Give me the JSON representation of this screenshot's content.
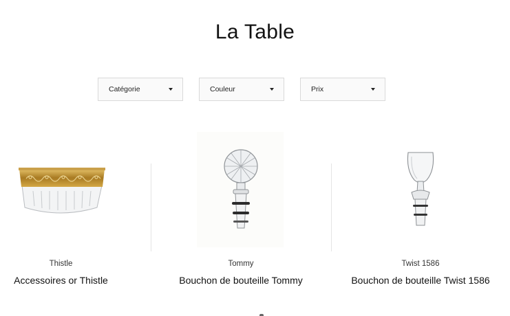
{
  "page": {
    "title": "La Table"
  },
  "filters": [
    {
      "label": "Catégorie"
    },
    {
      "label": "Couleur"
    },
    {
      "label": "Prix"
    }
  ],
  "products": [
    {
      "collection": "Thistle",
      "name": "Accessoires or Thistle",
      "image": "gold-rimmed-crystal-bowl"
    },
    {
      "collection": "Tommy",
      "name": "Bouchon de bouteille Tommy",
      "image": "crystal-ball-bottle-stopper"
    },
    {
      "collection": "Twist 1586",
      "name": "Bouchon de bouteille Twist 1586",
      "image": "crystal-glass-bottle-stopper"
    }
  ],
  "colors": {
    "text": "#111111",
    "border": "#d9d9d9",
    "gold": "#b8892a"
  }
}
